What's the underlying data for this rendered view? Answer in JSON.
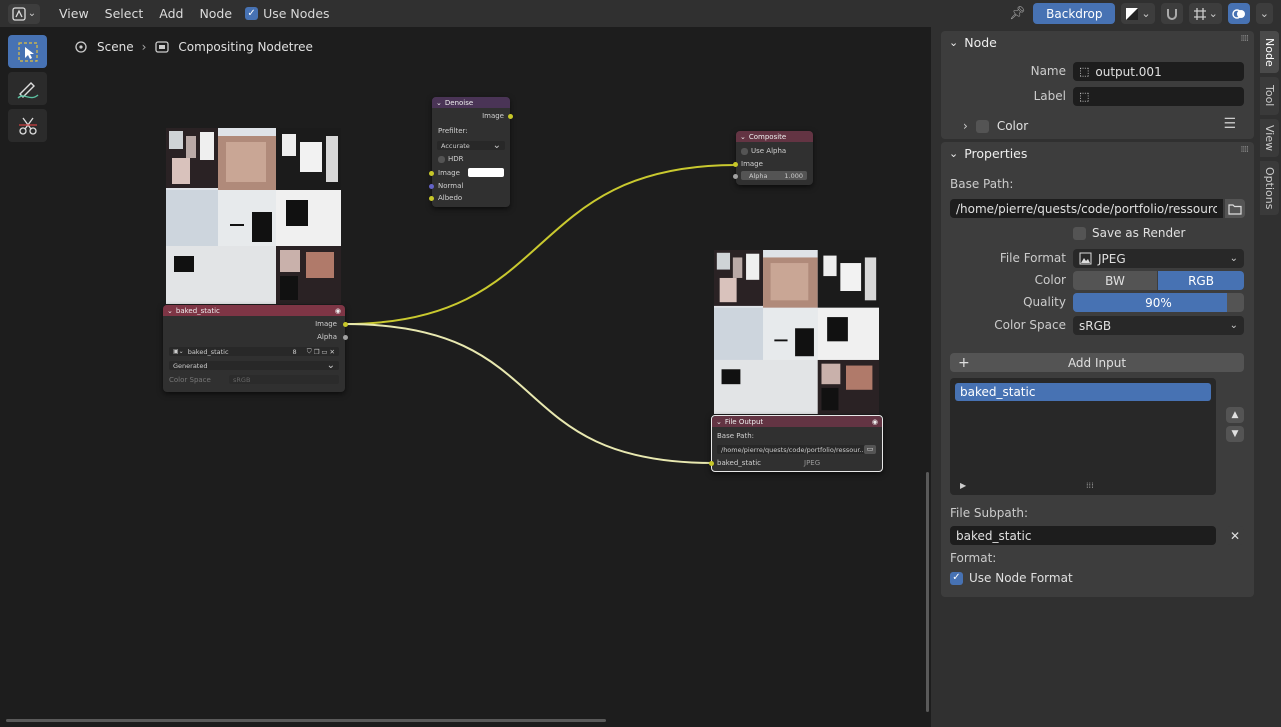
{
  "header": {
    "menu": [
      "View",
      "Select",
      "Add",
      "Node"
    ],
    "use_nodes_label": "Use Nodes",
    "backdrop_label": "Backdrop"
  },
  "breadcrumb": {
    "scene": "Scene",
    "tree": "Compositing Nodetree"
  },
  "nodes": {
    "image": {
      "title": "baked_static",
      "out_image": "Image",
      "out_alpha": "Alpha",
      "image_name": "baked_static",
      "users": "8",
      "source": "Generated",
      "colorspace_label": "Color Space",
      "colorspace_value": "sRGB"
    },
    "denoise": {
      "title": "Denoise",
      "out_image": "Image",
      "prefilter_label": "Prefilter:",
      "prefilter_value": "Accurate",
      "hdr_label": "HDR",
      "in_image": "Image",
      "in_normal": "Normal",
      "in_albedo": "Albedo"
    },
    "composite": {
      "title": "Composite",
      "use_alpha": "Use Alpha",
      "in_image": "Image",
      "alpha_label": "Alpha",
      "alpha_value": "1.000"
    },
    "file_output": {
      "title": "File Output",
      "base_path_label": "Base Path:",
      "base_path": "/home/pierre/quests/code/portfolio/ressour...",
      "input_name": "baked_static",
      "input_format": "JPEG"
    }
  },
  "sidebar": {
    "tabs": [
      "Node",
      "Tool",
      "View",
      "Options"
    ],
    "node_panel": {
      "title": "Node",
      "name_label": "Name",
      "name_value": "output.001",
      "label_label": "Label",
      "label_value": "",
      "color_label": "Color"
    },
    "properties_panel": {
      "title": "Properties",
      "base_path_label": "Base Path:",
      "base_path_value": "/home/pierre/quests/code/portfolio/ressources/",
      "save_as_render": "Save as Render",
      "file_format_label": "File Format",
      "file_format_value": "JPEG",
      "color_label": "Color",
      "color_options": [
        "BW",
        "RGB"
      ],
      "color_selected": "RGB",
      "quality_label": "Quality",
      "quality_value": "90%",
      "quality_fraction": 0.9,
      "color_space_label": "Color Space",
      "color_space_value": "sRGB",
      "add_input_label": "Add Input",
      "inputs": [
        "baked_static"
      ],
      "file_subpath_label": "File Subpath:",
      "file_subpath_value": "baked_static",
      "format_label": "Format:",
      "use_node_format": "Use Node Format"
    }
  },
  "colors": {
    "accent": "#4772b3",
    "image_header": "#7e3545",
    "denoise_header": "#4a3456",
    "output_header": "#633443",
    "image_socket": "#c7c729",
    "vector_socket": "#6363c7"
  }
}
